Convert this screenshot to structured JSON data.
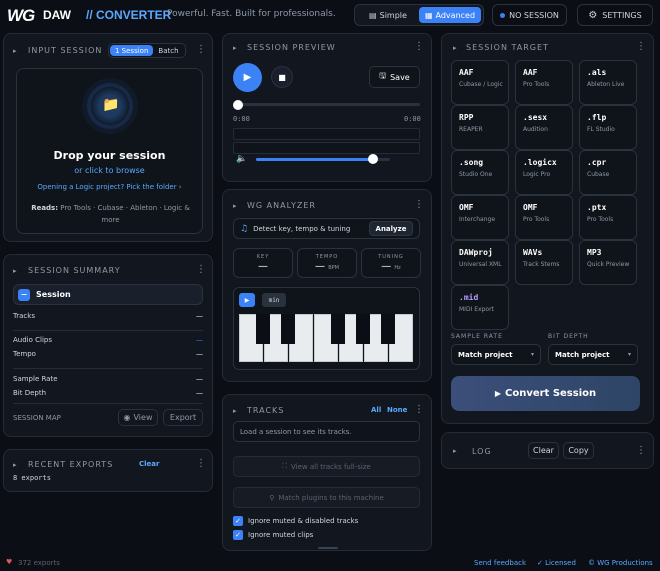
{
  "header": {
    "logo": "WG",
    "brand_daw": "DAW",
    "brand_converter": "// CONVERTER",
    "tagline": "Powerful. Fast. Built for professionals.",
    "mode_simple": "Simple",
    "mode_advanced": "Advanced",
    "session_status": "NO SESSION",
    "settings": "SETTINGS"
  },
  "input_session": {
    "title": "INPUT SESSION",
    "tab_1session": "1 Session",
    "tab_batch": "Batch",
    "drop_title": "Drop your session",
    "drop_sub": "or click to browse",
    "logic_link": "Opening a Logic project? Pick the folder ›",
    "reads_label": "Reads:",
    "reads_text": "Pro Tools · Cubase · Ableton · Logic & more"
  },
  "session_summary": {
    "title": "SESSION SUMMARY",
    "head_label": "Session",
    "rows": [
      {
        "label": "Tracks",
        "value": "—"
      },
      {
        "label": "Audio Clips",
        "value": "—"
      },
      {
        "label": "Tempo",
        "value": "—"
      },
      {
        "label": "Sample Rate",
        "value": "—"
      },
      {
        "label": "Bit Depth",
        "value": "—"
      }
    ],
    "map_label": "SESSION MAP",
    "view_btn": "View",
    "export_btn": "Export"
  },
  "recent_exports": {
    "title": "RECENT EXPORTS",
    "clear": "Clear",
    "count": "8 exports"
  },
  "session_preview": {
    "title": "SESSION PREVIEW",
    "save": "Save",
    "time_start": "0:00",
    "time_end": "0:00",
    "progress": 0,
    "volume": 0.87
  },
  "wg_analyzer": {
    "title": "WG ANALYZER",
    "prompt": "Detect key, tempo & tuning",
    "analyze": "Analyze",
    "key_label": "KEY",
    "key_value": "—",
    "tempo_label": "TEMPO",
    "tempo_value": "—",
    "tempo_unit": "BPM",
    "tuning_label": "TUNING",
    "tuning_value": "—",
    "tuning_unit": "Hz",
    "chip": "min"
  },
  "tracks": {
    "title": "TRACKS",
    "all": "All",
    "none": "None",
    "placeholder": "Load a session to see its tracks.",
    "view_all": "View all tracks full-size",
    "match_plugins": "Match plugins to this machine",
    "opt1": "Ignore muted & disabled tracks",
    "opt2": "Ignore muted clips"
  },
  "session_target": {
    "title": "SESSION TARGET",
    "targets": [
      {
        "fmt": "AAF",
        "desc": "Cubase / Logic"
      },
      {
        "fmt": "AAF",
        "desc": "Pro Tools"
      },
      {
        "fmt": ".als",
        "desc": "Ableton Live"
      },
      {
        "fmt": "RPP",
        "desc": "REAPER"
      },
      {
        "fmt": ".sesx",
        "desc": "Audition"
      },
      {
        "fmt": ".flp",
        "desc": "FL Studio"
      },
      {
        "fmt": ".song",
        "desc": "Studio One"
      },
      {
        "fmt": ".logicx",
        "desc": "Logic Pro"
      },
      {
        "fmt": ".cpr",
        "desc": "Cubase"
      },
      {
        "fmt": "OMF",
        "desc": "Interchange"
      },
      {
        "fmt": "OMF",
        "desc": "Pro Tools"
      },
      {
        "fmt": ".ptx",
        "desc": "Pro Tools"
      },
      {
        "fmt": "DAWproj",
        "desc": "Universal XML"
      },
      {
        "fmt": "WAVs",
        "desc": "Track Stems"
      },
      {
        "fmt": "MP3",
        "desc": "Quick Preview"
      },
      {
        "fmt": ".mid",
        "desc": "MIDI Export"
      }
    ],
    "sample_rate_label": "SAMPLE RATE",
    "sample_rate_value": "Match project",
    "bit_depth_label": "BIT DEPTH",
    "bit_depth_value": "Match project",
    "convert": "Convert Session"
  },
  "log": {
    "title": "LOG",
    "clear": "Clear",
    "copy": "Copy"
  },
  "footer": {
    "exports": "372 exports",
    "feedback": "Send feedback",
    "licensed": "✓ Licensed",
    "copyright": "© WG Productions"
  },
  "colors": {
    "accent": "#3b82f6",
    "background": "#0b0e14",
    "panel": "#12161e"
  }
}
